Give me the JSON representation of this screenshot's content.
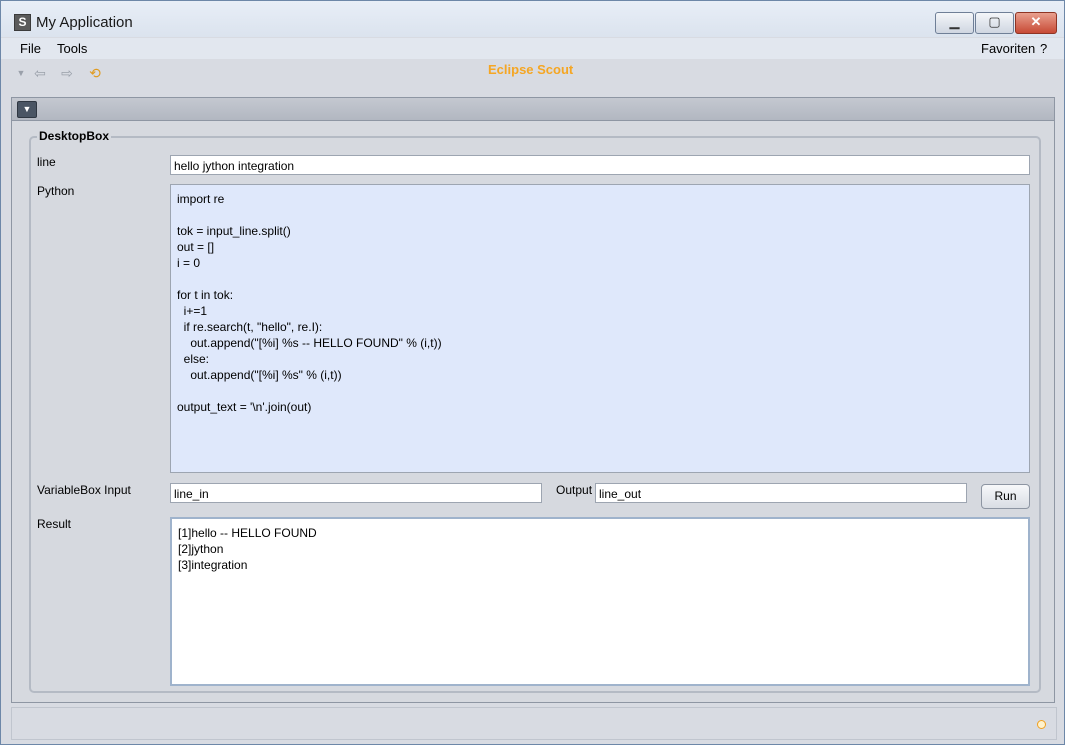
{
  "window": {
    "title": "My Application",
    "app_icon": "S",
    "controls": {
      "minimize": "▁",
      "maximize": "▢",
      "close": "✕"
    }
  },
  "menubar": {
    "left": [
      {
        "label": "File"
      },
      {
        "label": "Tools"
      }
    ],
    "right": [
      {
        "label": "Favoriten"
      },
      {
        "label": "?"
      }
    ]
  },
  "toolbar": {
    "icons": [
      "dropdown-arrow-icon",
      "back-arrow-icon",
      "forward-arrow-icon",
      "refresh-icon"
    ],
    "brand": "Eclipse Scout",
    "brand_color": "#f5a623"
  },
  "desktop": {
    "group_title": "DesktopBox",
    "line": {
      "label": "line",
      "value": "hello jython integration"
    },
    "python": {
      "label": "Python",
      "code": "import re\n\ntok = input_line.split()\nout = []\ni = 0\n\nfor t in tok:\n  i+=1\n  if re.search(t, \"hello\", re.I):\n    out.append(\"[%i] %s -- HELLO FOUND\" % (i,t))\n  else:\n    out.append(\"[%i] %s\" % (i,t))\n\noutput_text = '\\n'.join(out)",
      "bg": "#dfe8fb"
    },
    "variable_box": {
      "label": "VariableBox Input",
      "input_value": "line_in",
      "output_label": "Output",
      "output_value": "line_out"
    },
    "run_button": "Run",
    "result": {
      "label": "Result",
      "text": "[1]hello -- HELLO FOUND\n[2]jython\n[3]integration"
    }
  }
}
